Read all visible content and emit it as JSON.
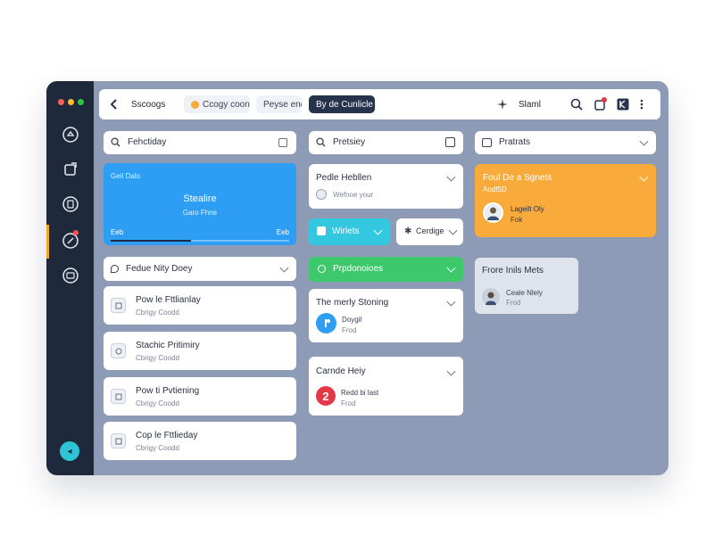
{
  "topbar": {
    "title": "Sscoogs",
    "chip1": "Ccogy coonn",
    "chip2": "Peyse end",
    "chip3": "By de Cunlicle",
    "share_label": "Slaml"
  },
  "columns": [
    {
      "header": "Fehctiday",
      "hero": {
        "top": "Geil Dalo",
        "title": "Stealire",
        "sub": "Garo Fhne",
        "foot_left": "Eeb",
        "foot_right": "Eeb",
        "progress": 0.45
      },
      "section": "Fedue Nity Doey",
      "items": [
        {
          "title": "Pow le Fttlianlay",
          "sub": "Cbrigy Coodd"
        },
        {
          "title": "Stachic Pritimiry",
          "sub": "Cbrigy Coodd"
        },
        {
          "title": "Pow ti Pvtiening",
          "sub": "Cbrigy Coodd"
        },
        {
          "title": "Cop le Fttlieday",
          "sub": "Cbrigy Coodd"
        }
      ]
    },
    {
      "header": "Pretsiey",
      "card1": {
        "title": "Pedle Hebllen",
        "sub": "Wefnoe your"
      },
      "write_label": "Wirlets",
      "config_label": "Cerdige",
      "pill_label": "Prpdonoioes",
      "card2": {
        "title": "The merly Stoning",
        "row_title": "Doygil",
        "row_sub": "Frod"
      },
      "card3": {
        "title": "Carnde Heiy",
        "row_title": "Redd bi last",
        "row_sub": "Frod",
        "badge": "2"
      }
    },
    {
      "header": "Pratrats",
      "orange": {
        "title": "Foul De a Sgnets",
        "sub": "Aodf5D",
        "person": "Lageilt Oly",
        "person_sub": "Fok"
      },
      "small": {
        "title": "Frore Inils Mets",
        "person": "Ceale Nlely",
        "person_sub": "Frod"
      }
    }
  ],
  "colors": {
    "accent": "#2e9ef4",
    "orange": "#f8ab3b",
    "green": "#3dc96b",
    "cyan": "#34c8e0",
    "red": "#e23946",
    "sidebar": "#1e2a3b"
  }
}
